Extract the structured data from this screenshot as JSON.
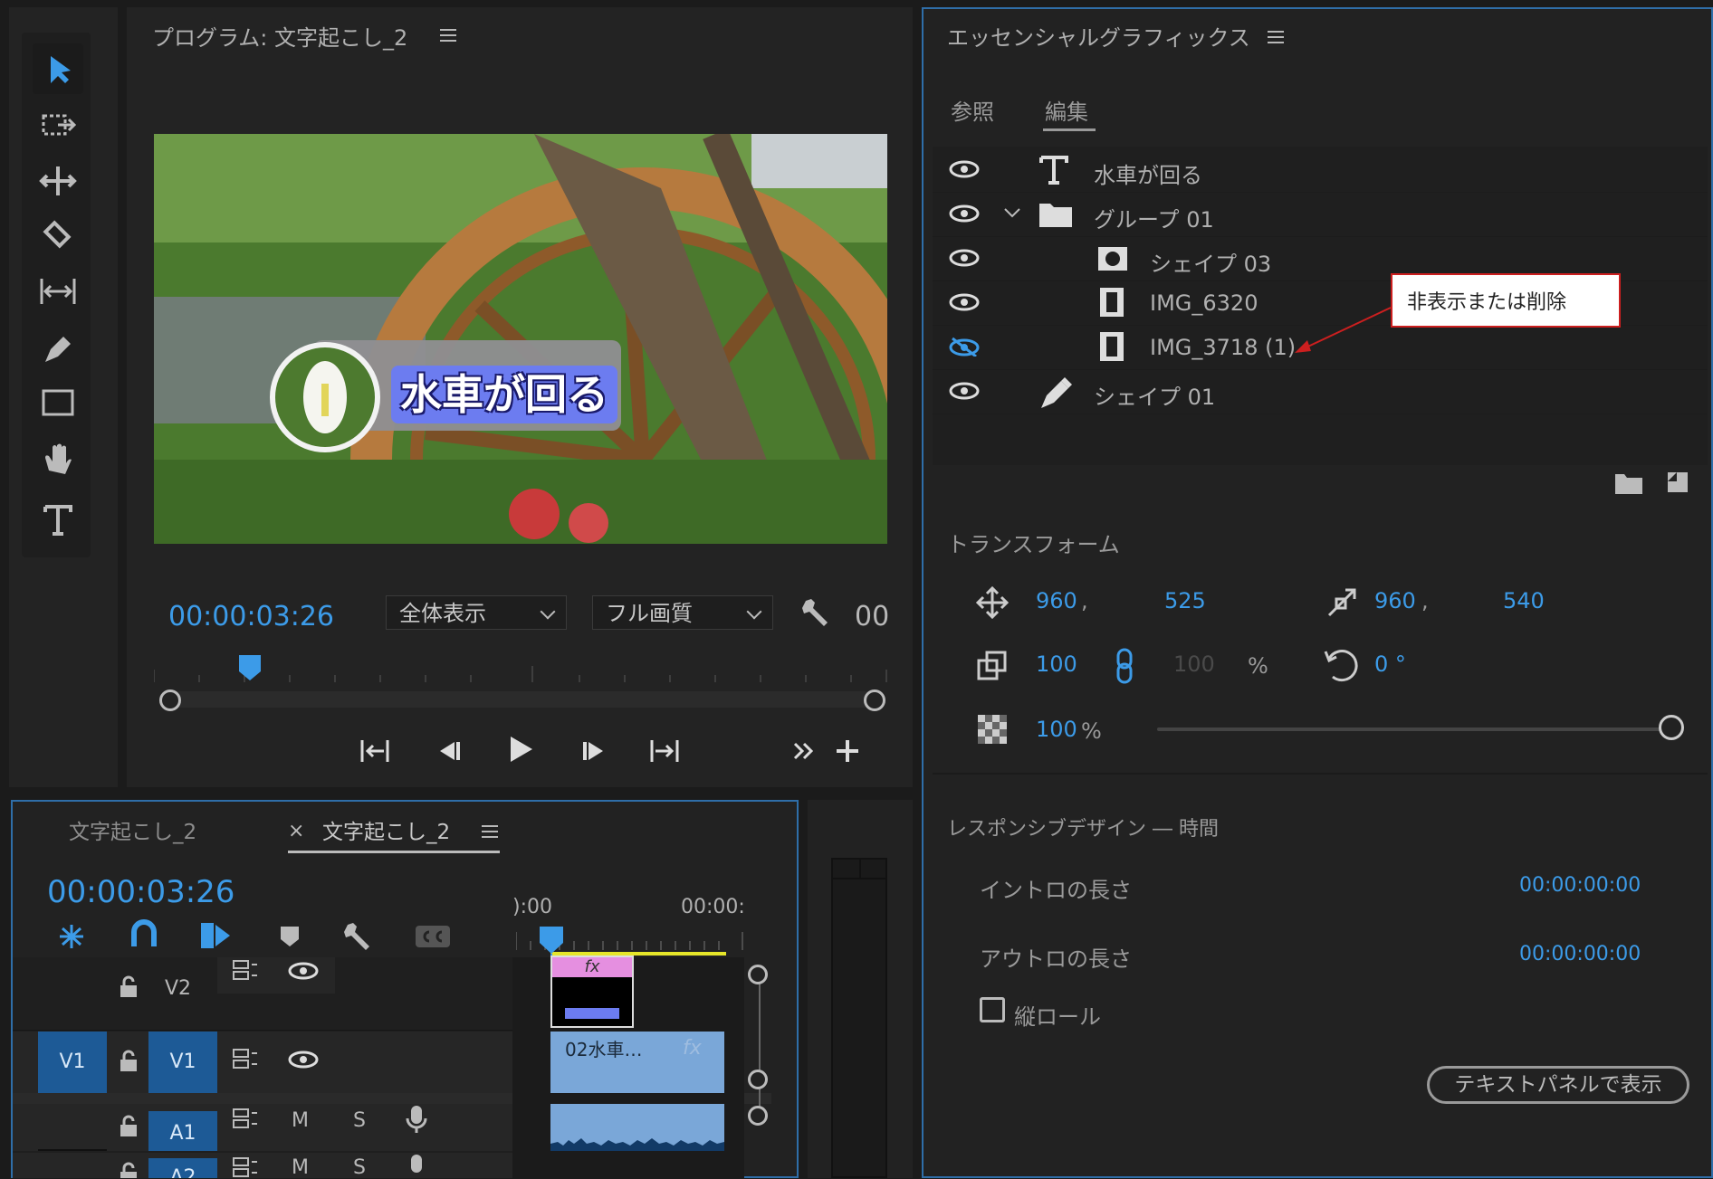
{
  "program_monitor": {
    "title": "プログラム: 文字起こし_2",
    "timecode": "00:00:03:26",
    "zoom_select": "全体表示",
    "quality_select": "フル画質",
    "right_timecode": "00",
    "video_caption": "水車が回る"
  },
  "toolbar": {
    "tools": [
      "selection-tool",
      "track-select-tool",
      "ripple-edit-tool",
      "razor-tool",
      "slip-tool",
      "pen-tool",
      "rectangle-tool",
      "hand-tool",
      "type-tool"
    ]
  },
  "essential_graphics": {
    "title": "エッセンシャルグラフィックス",
    "tabs": [
      "参照",
      "編集"
    ],
    "active_tab": "編集",
    "layers": [
      {
        "label": "水車が回る",
        "icon": "type-icon",
        "visible": true
      },
      {
        "label": "グループ 01",
        "icon": "folder-icon",
        "visible": true
      },
      {
        "label": "シェイプ 03",
        "icon": "shape-mask-icon",
        "visible": true
      },
      {
        "label": "IMG_6320",
        "icon": "film-icon",
        "visible": true
      },
      {
        "label": "IMG_3718 (1)",
        "icon": "film-icon",
        "visible": false
      },
      {
        "label": "シェイプ 01",
        "icon": "pen-icon",
        "visible": true
      }
    ],
    "callout_text": "非表示または削除",
    "transform": {
      "heading": "トランスフォーム",
      "position_x": "960",
      "position_y": "525",
      "anchor_x": "960",
      "anchor_y": "540",
      "scale": "100",
      "scale_linked": "100",
      "scale_unit": "%",
      "rotation": "0 °",
      "opacity": "100",
      "opacity_unit": "%",
      "opacity_fraction": 1.0
    },
    "responsive": {
      "heading": "レスポンシブデザイン ― 時間",
      "intro_label": "イントロの長さ",
      "intro_value": "00:00:00:00",
      "outro_label": "アウトロの長さ",
      "outro_value": "00:00:00:00",
      "roll_label": "縦ロール",
      "text_panel_button": "テキストパネルで表示"
    }
  },
  "timeline": {
    "tab1": "文字起こし_2",
    "tab2": "文字起こし_2",
    "timecode": "00:00:03:26",
    "ruler_start": "):00",
    "ruler_end": "00:00:",
    "tracks": {
      "v2": "V2",
      "v1_source": "V1",
      "v1": "V1",
      "a1": "A1",
      "a2": "A2",
      "mute": "M",
      "solo": "S"
    },
    "clip_label": "02水車…",
    "fx_label": "fx"
  },
  "colors": {
    "accent_blue": "#3c9be8",
    "callout_border": "#cc1f1f",
    "clip_video": "#7aa7d8",
    "clip_fx_pink": "#e58fe0",
    "track_blue": "#1d5a96"
  }
}
